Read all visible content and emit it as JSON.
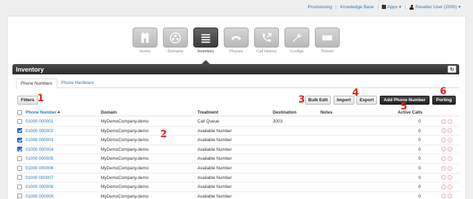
{
  "topnav": {
    "provisioning": "Provisioning",
    "knowledge_base": "Knowledge Base",
    "apps": "Apps",
    "user": "Reseller User (2000)"
  },
  "tiles": [
    {
      "label": "Home",
      "icon": "home-icon",
      "active": false
    },
    {
      "label": "Domains",
      "icon": "domains-icon",
      "active": false
    },
    {
      "label": "Inventory",
      "icon": "inventory-icon",
      "active": true
    },
    {
      "label": "Phones",
      "icon": "phone-icon",
      "active": false
    },
    {
      "label": "Call History",
      "icon": "call-history-icon",
      "active": false
    },
    {
      "label": "Configs",
      "icon": "wrench-icon",
      "active": false
    },
    {
      "label": "Tickets",
      "icon": "ticket-icon",
      "active": false
    }
  ],
  "section": {
    "title": "Inventory"
  },
  "tabs": {
    "phone_numbers": "Phone Numbers",
    "phone_hardware": "Phone Hardware"
  },
  "toolbar": {
    "filters": "Filters",
    "bulk_edit": "Bulk Edit",
    "import": "Import",
    "export": "Export",
    "add_phone_number": "Add Phone Number",
    "porting": "Porting"
  },
  "annotations": [
    "1",
    "2",
    "3",
    "4",
    "5",
    "6"
  ],
  "table": {
    "headers": {
      "phone_number": "Phone Number",
      "domain": "Domain",
      "treatment": "Treatment",
      "destination": "Destination",
      "notes": "Notes",
      "active_calls": "Active Calls"
    },
    "rows": [
      {
        "number": "01000 000001",
        "domain": "MyDemoCompany.demo",
        "treatment": "Call Queue",
        "destination": "3003",
        "notes": "",
        "active_calls": "0",
        "checked": false
      },
      {
        "number": "01000 000002",
        "domain": "MyDemoCompany.demo",
        "treatment": "Available Number",
        "destination": "",
        "notes": "",
        "active_calls": "0",
        "checked": true
      },
      {
        "number": "01000 000003",
        "domain": "MyDemoCompany.demo",
        "treatment": "Available Number",
        "destination": "",
        "notes": "",
        "active_calls": "0",
        "checked": true
      },
      {
        "number": "01000 000004",
        "domain": "MyDemoCompany.demo",
        "treatment": "Available Number",
        "destination": "",
        "notes": "",
        "active_calls": "0",
        "checked": true
      },
      {
        "number": "01000 000005",
        "domain": "MyDemoCompany.demo",
        "treatment": "Available Number",
        "destination": "",
        "notes": "",
        "active_calls": "0",
        "checked": false
      },
      {
        "number": "01000 000006",
        "domain": "MyDemoCompany.demo",
        "treatment": "Available Number",
        "destination": "",
        "notes": "",
        "active_calls": "0",
        "checked": false
      },
      {
        "number": "01000 000007",
        "domain": "MyDemoCompany.demo",
        "treatment": "Available Number",
        "destination": "",
        "notes": "",
        "active_calls": "0",
        "checked": false
      },
      {
        "number": "01000 000008",
        "domain": "MyDemoCompany.demo",
        "treatment": "Available Number",
        "destination": "",
        "notes": "",
        "active_calls": "0",
        "checked": false
      },
      {
        "number": "01000 000009",
        "domain": "MyDemoCompany.demo",
        "treatment": "Available Number",
        "destination": "",
        "notes": "",
        "active_calls": "0",
        "checked": false
      }
    ]
  },
  "colors": {
    "link": "#2a7ab8",
    "annotation": "#e1251b",
    "bar": "#333333",
    "checkbox": "#2a6fd6"
  }
}
